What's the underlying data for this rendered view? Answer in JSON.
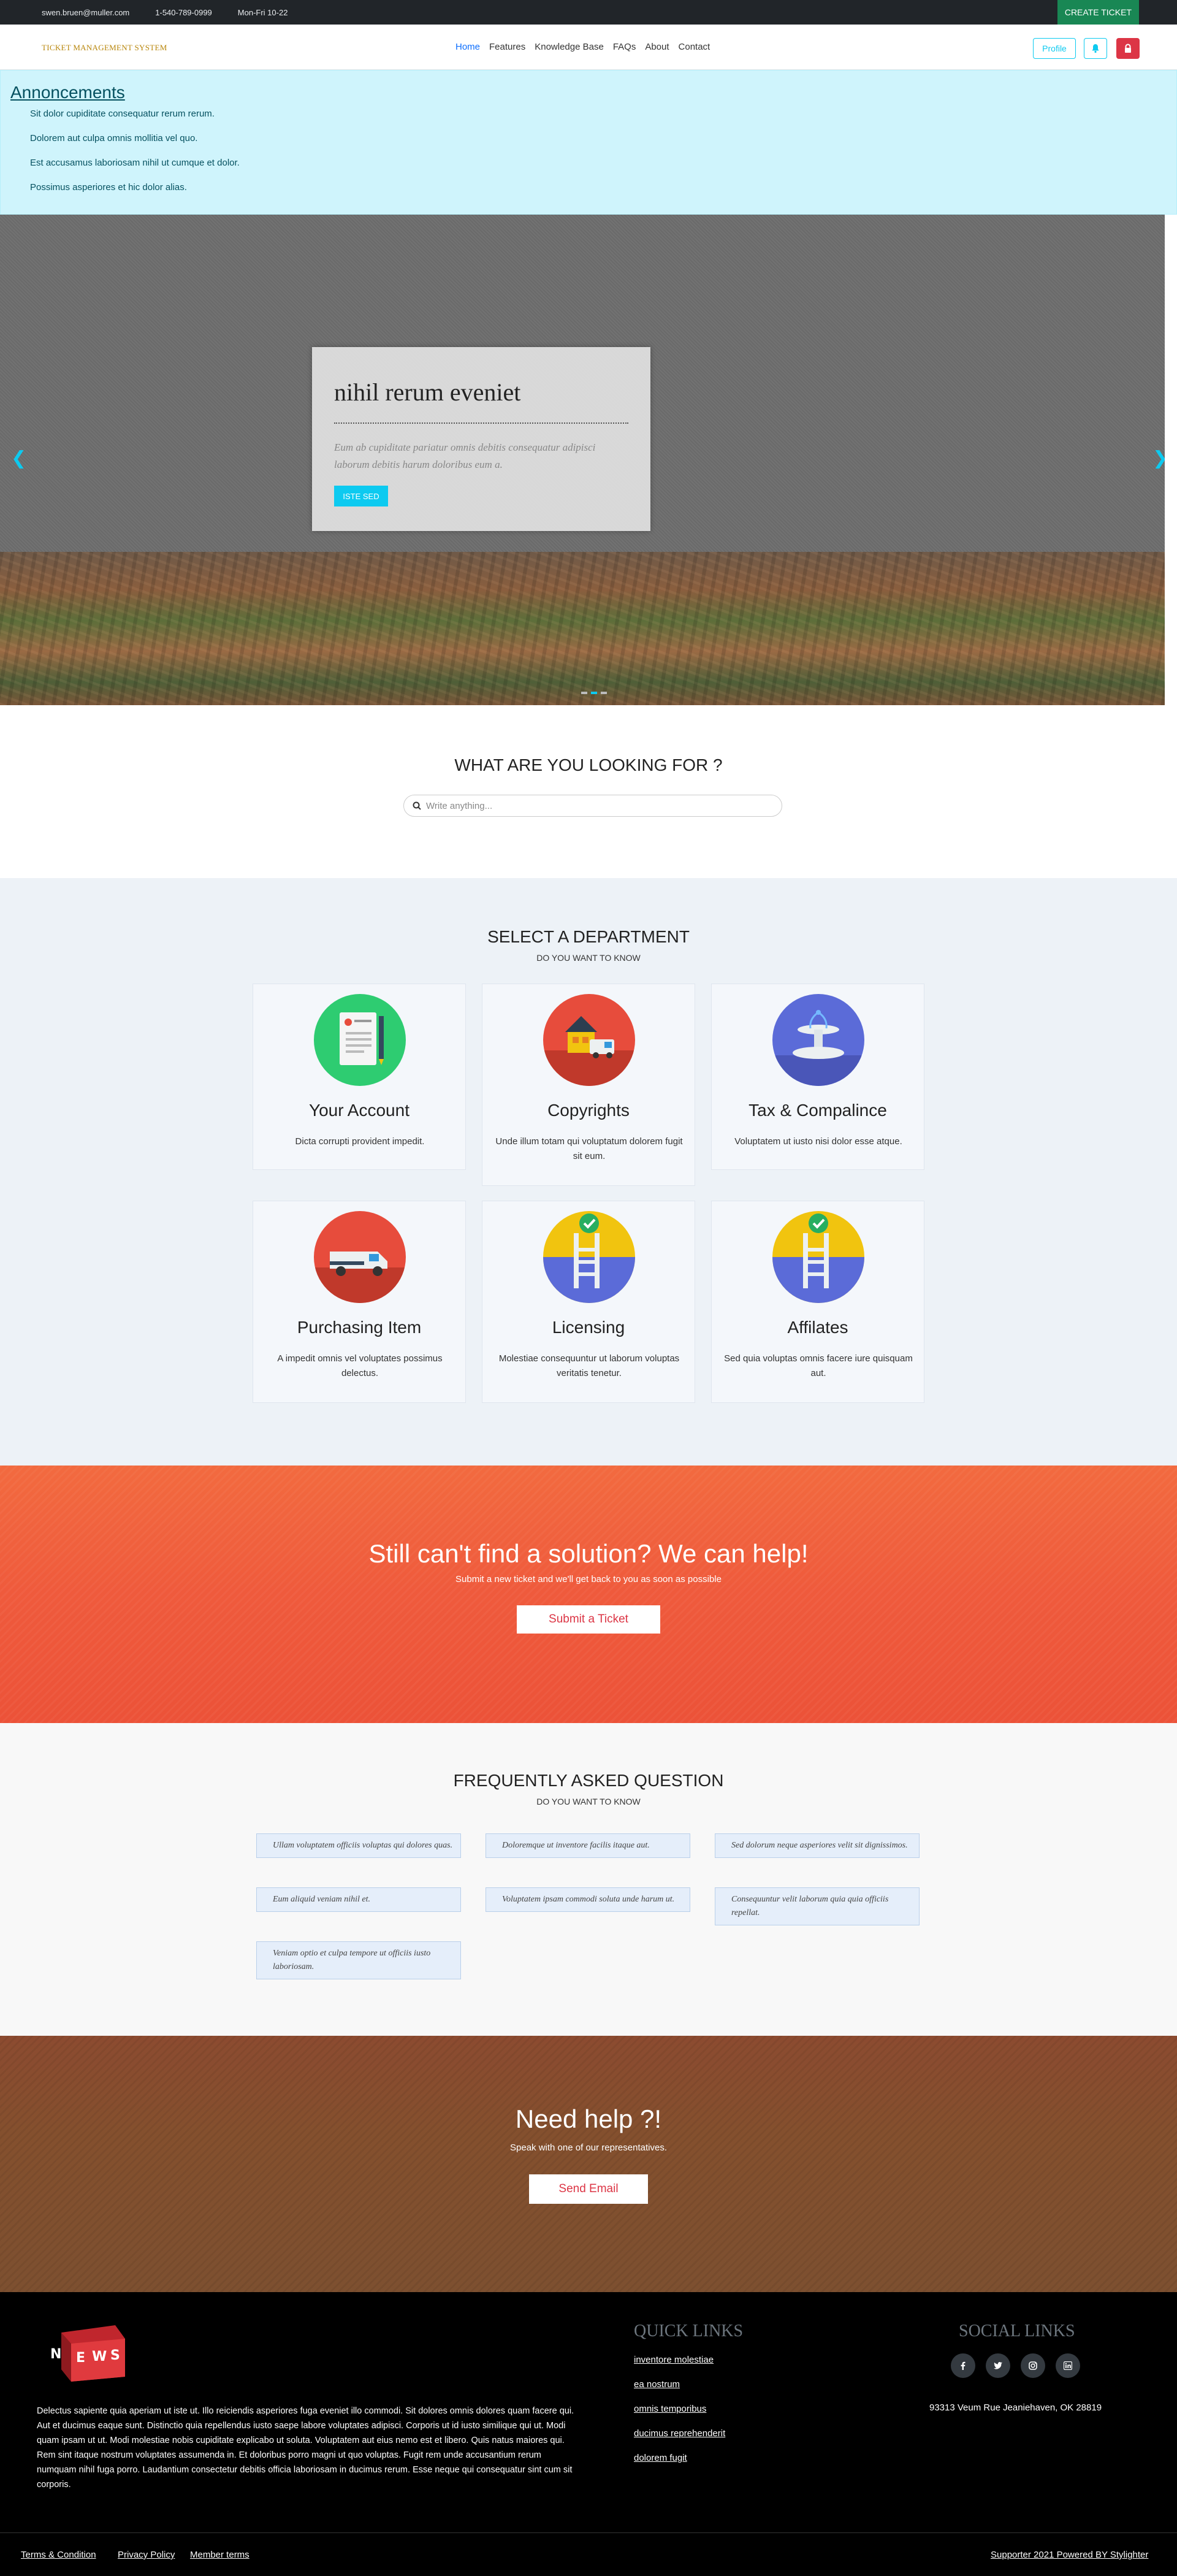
{
  "topbar": {
    "email": "swen.bruen@muller.com",
    "phone": "1-540-789-0999",
    "hours": "Mon-Fri 10-22",
    "create_ticket": "CREATE TICKET"
  },
  "navbar": {
    "brand": "TICKET MANAGEMENT SYSTEM",
    "links": [
      "Home",
      "Features",
      "Knowledge Base",
      "FAQs",
      "About",
      "Contact"
    ],
    "active_link": "Home",
    "profile_label": "Profile"
  },
  "announcements": {
    "title": "Annoncements",
    "items": [
      "Sit dolor cupiditate consequatur rerum rerum.",
      "Dolorem aut culpa omnis mollitia vel quo.",
      "Est accusamus laboriosam nihil ut cumque et dolor.",
      "Possimus asperiores et hic dolor alias."
    ]
  },
  "carousel": {
    "title": "nihil rerum eveniet",
    "text": "Eum ab cupiditate pariatur omnis debitis consequatur adipisci laborum debitis harum doloribus eum a.",
    "button": "ISTE SED",
    "prev_icon": "chevron-left-icon",
    "next_icon": "chevron-right-icon",
    "slide_count": 3,
    "active_slide": 2
  },
  "search": {
    "title": "WHAT ARE YOU LOOKING FOR ?",
    "placeholder": "Write anything..."
  },
  "departments": {
    "title": "SELECT A DEPARTMENT",
    "subtitle": "DO YOU WANT TO KNOW",
    "items": [
      {
        "name": "Your Account",
        "desc": "Dicta corrupti provident impedit.",
        "icon": "document-icon",
        "color": "#2ecc71"
      },
      {
        "name": "Copyrights",
        "desc": "Unde illum totam qui voluptatum dolorem fugit sit eum.",
        "icon": "house-truck-icon",
        "color": "#e74c3c"
      },
      {
        "name": "Tax & Compalince",
        "desc": "Voluptatem ut iusto nisi dolor esse atque.",
        "icon": "fountain-icon",
        "color": "#5b6bd8"
      },
      {
        "name": "Purchasing Item",
        "desc": "A impedit omnis vel voluptates possimus delectus.",
        "icon": "truck-icon",
        "color": "#e74c3c"
      },
      {
        "name": "Licensing",
        "desc": "Molestiae consequuntur ut laborum voluptas veritatis tenetur.",
        "icon": "pool-check-icon",
        "color": "#f1c40f"
      },
      {
        "name": "Affilates",
        "desc": "Sed quia voluptas omnis facere iure quisquam aut.",
        "icon": "pool-check-icon",
        "color": "#f1c40f"
      }
    ]
  },
  "cta": {
    "title": "Still can't find a solution? We can help!",
    "subtitle": "Submit a new ticket and we'll get back to you as soon as possible",
    "button": "Submit a Ticket"
  },
  "faq": {
    "title": "FREQUENTLY ASKED QUESTION",
    "subtitle": "DO YOU WANT TO KNOW",
    "items": [
      "Ullam voluptatem officiis voluptas qui dolores quas.",
      "Doloremque ut inventore facilis itaque aut.",
      "Sed dolorum neque asperiores velit sit dignissimos.",
      "Eum aliquid veniam nihil et.",
      "Voluptatem ipsam commodi soluta unde harum ut.",
      "Consequuntur velit laborum quia quia officiis repellat.",
      "Veniam optio et culpa tempore ut officiis iusto laboriosam."
    ]
  },
  "help": {
    "title": "Need help ?!",
    "subtitle": "Speak with one of our representatives.",
    "button": "Send Email"
  },
  "footer": {
    "logo_text": "NEWS",
    "description": "Delectus sapiente quia aperiam ut iste ut. Illo reiciendis asperiores fuga eveniet illo commodi. Sit dolores omnis dolores quam facere qui. Aut et ducimus eaque sunt. Distinctio quia repellendus iusto saepe labore voluptates adipisci. Corporis ut id iusto similique qui ut. Modi quam ipsam ut ut. Modi molestiae nobis cupiditate explicabo ut soluta. Voluptatem aut eius nemo est et libero. Quis natus maiores qui. Rem sint itaque nostrum voluptates assumenda in. Et doloribus porro magni ut quo voluptas. Fugit rem unde accusantium rerum numquam nihil fuga porro. Laudantium consectetur debitis officia laboriosam in ducimus rerum. Esse neque qui consequatur sint cum sit corporis.",
    "quick_links_title": "QUICK LINKS",
    "quick_links": [
      "inventore molestiae",
      "ea nostrum",
      "omnis temporibus",
      "ducimus reprehenderit",
      "dolorem fugit"
    ],
    "social_title": "SOCIAL LINKS",
    "social_icons": [
      "facebook-icon",
      "twitter-icon",
      "instagram-icon",
      "linkedin-icon"
    ],
    "address": "93313 Veum Rue Jeaniehaven, OK 28819",
    "bottom_links": [
      "Terms & Condition",
      "Privacy Policy",
      "Member terms"
    ],
    "credit": "Supporter 2021 Powered BY Stylighter"
  }
}
